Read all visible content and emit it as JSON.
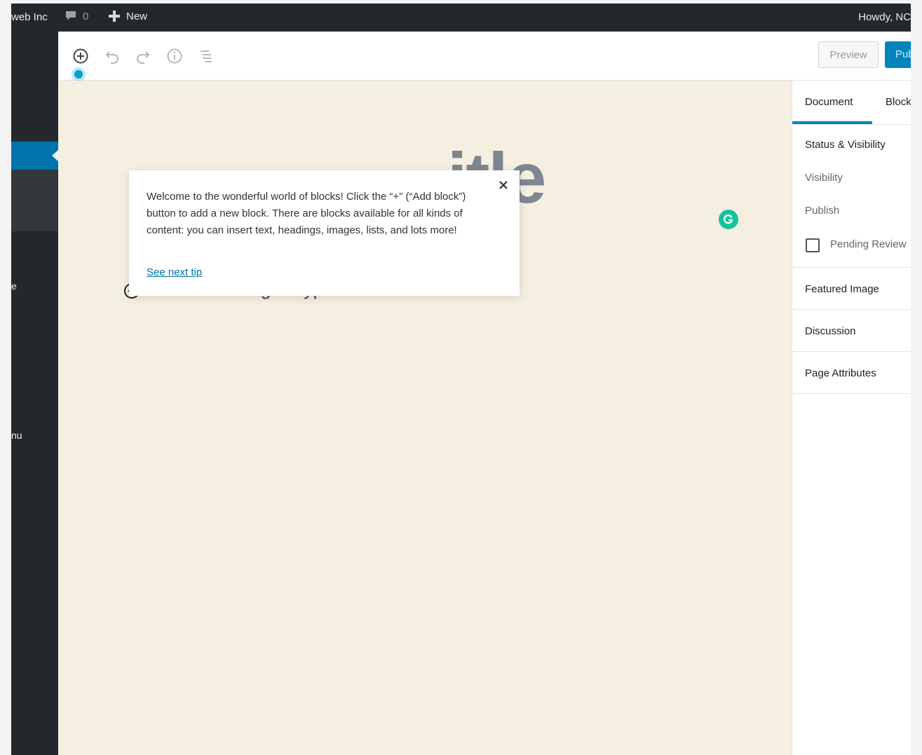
{
  "adminbar": {
    "site_name": "web Inc",
    "comments_count": "0",
    "new_label": "New",
    "howdy": "Howdy, NC"
  },
  "leftmenu": {
    "fragment_1": "e",
    "fragment_2": "nu"
  },
  "toolbar": {
    "icons": [
      "add-block-icon",
      "undo-icon",
      "redo-icon",
      "info-icon",
      "outline-icon"
    ],
    "preview_label": "Preview",
    "publish_label": "Publish"
  },
  "editor": {
    "title_fragment": "itle",
    "placeholder": "Start writing or type / to choose a block"
  },
  "tip": {
    "text": "Welcome to the wonderful world of blocks! Click the “+” (“Add block”) button to add a new block. There are blocks available for all kinds of content: you can insert text, headings, images, lists, and lots more!",
    "link": "See next tip"
  },
  "sidebar": {
    "tabs": [
      "Document",
      "Block"
    ],
    "status_visibility": "Status & Visibility",
    "visibility": "Visibility",
    "publish": "Publish",
    "pending_review": "Pending Review",
    "featured_image": "Featured Image",
    "discussion": "Discussion",
    "page_attributes": "Page Attributes"
  },
  "colors": {
    "admin_dark": "#23282d",
    "accent_blue": "#0085ba",
    "canvas_bg": "#f4efe0",
    "grammarly_green": "#15c39a"
  }
}
